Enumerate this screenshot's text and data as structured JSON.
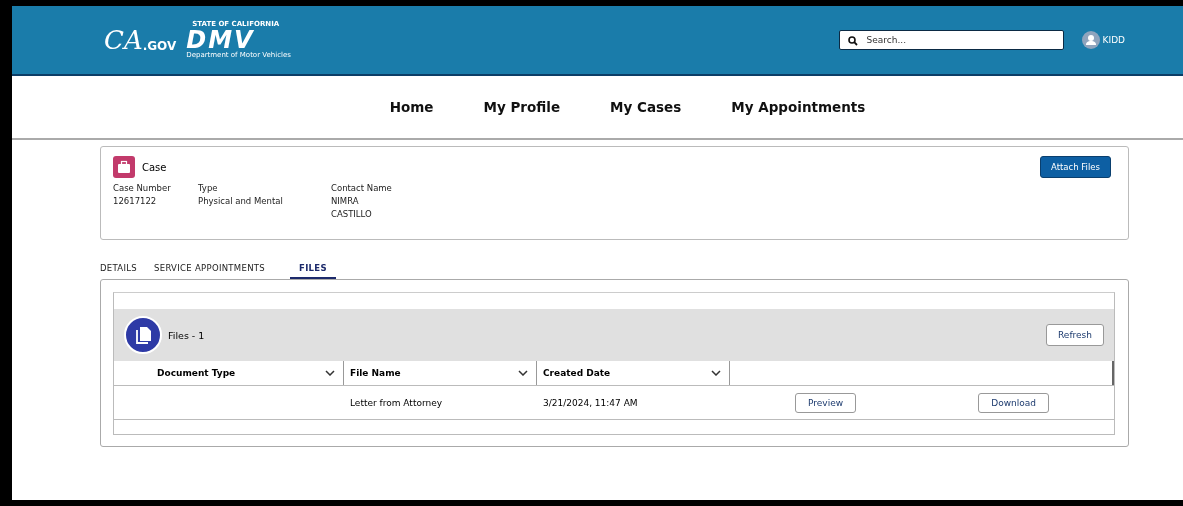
{
  "header": {
    "logo": {
      "ca": "CA",
      "gov": ".GOV",
      "state": "STATE OF CALIFORNIA",
      "dmv": "DMV",
      "department": "Department of Motor Vehicles"
    },
    "search": {
      "placeholder": "Search..."
    },
    "user": "KIDD"
  },
  "nav": [
    {
      "label": "Home"
    },
    {
      "label": "My Profile"
    },
    {
      "label": "My Cases"
    },
    {
      "label": "My Appointments"
    }
  ],
  "case": {
    "title": "Case",
    "button": "Attach Files",
    "fields": [
      {
        "label": "Case Number",
        "values": [
          "12617122"
        ]
      },
      {
        "label": "Type",
        "values": [
          "Physical and Mental"
        ]
      },
      {
        "label": "Contact Name",
        "values": [
          "NIMRA",
          "CASTILLO"
        ]
      }
    ]
  },
  "tabs": [
    {
      "label": "DETAILS",
      "selected": false
    },
    {
      "label": "SERVICE APPOINTMENTS",
      "selected": false
    },
    {
      "label": "FILES",
      "selected": true
    }
  ],
  "files": {
    "title": "Files - 1",
    "refresh": "Refresh",
    "columns": [
      "Document Type",
      "File Name",
      "Created Date"
    ],
    "rows": [
      {
        "document_type": "",
        "file_name": "Letter from Attorney",
        "created_date": "3/21/2024, 11:47 AM",
        "actions": [
          "Preview",
          "Download"
        ]
      }
    ]
  }
}
